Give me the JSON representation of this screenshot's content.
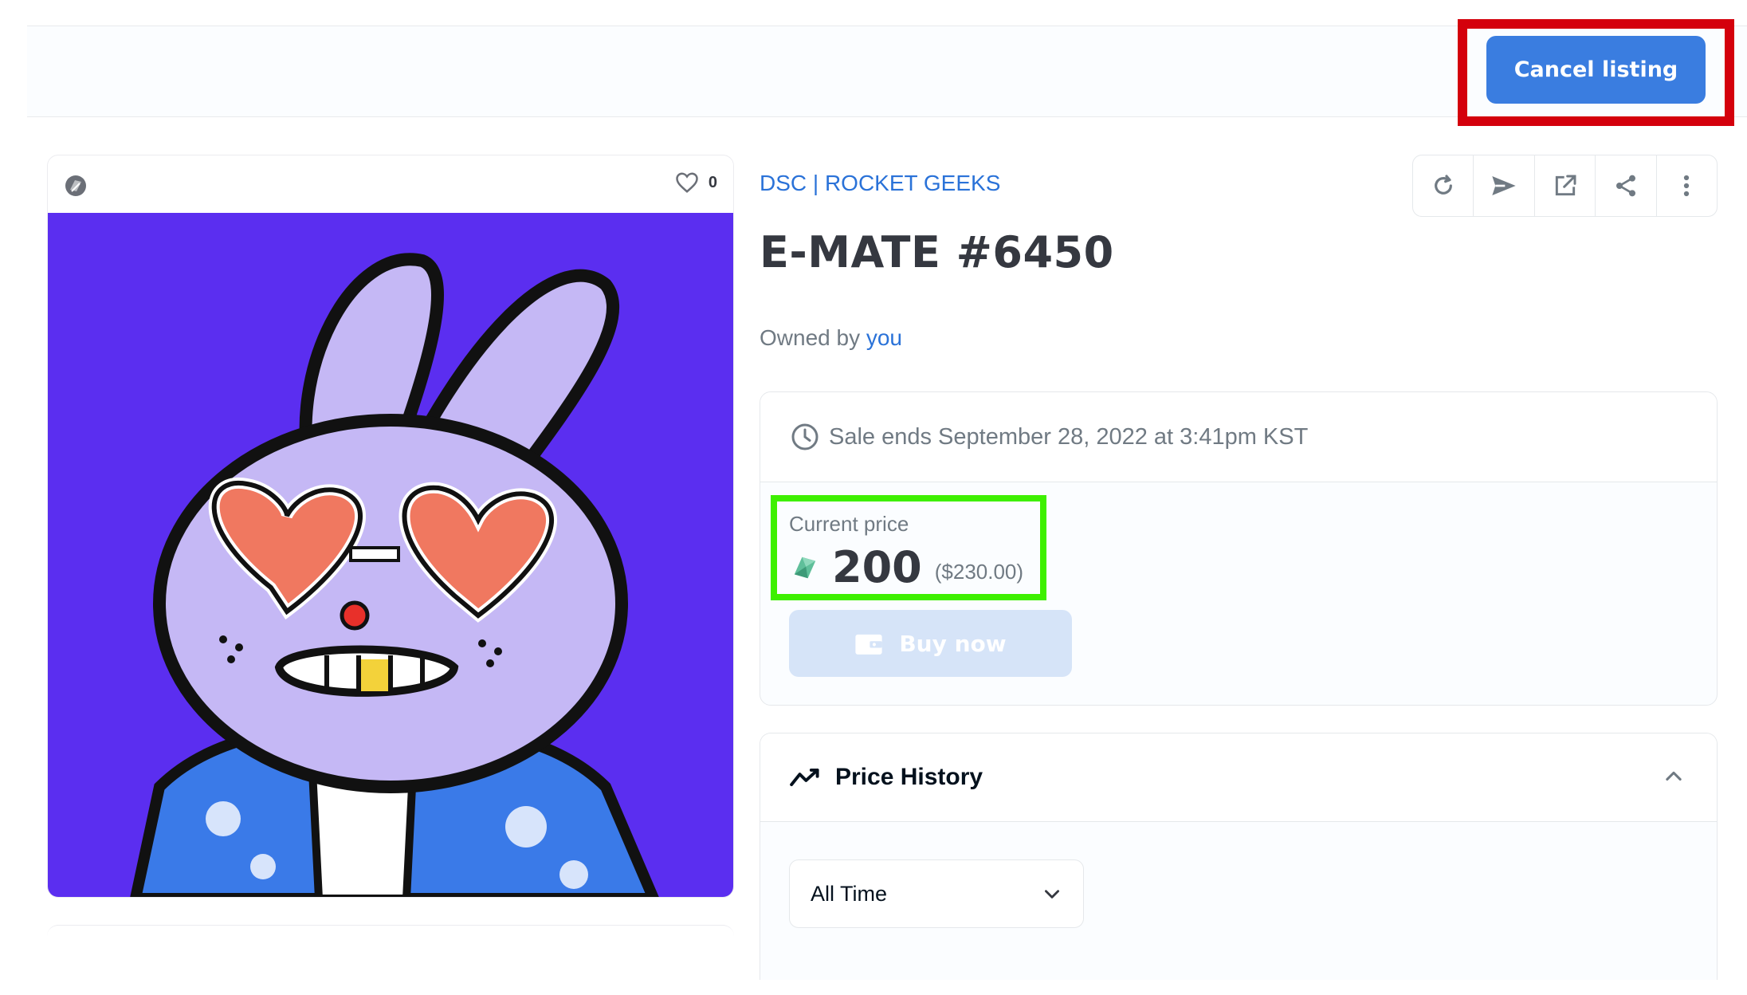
{
  "header": {
    "cancel_label": "Cancel listing"
  },
  "media": {
    "favorite_count": "0",
    "icons": [
      "chain-logo-icon",
      "heart-icon"
    ],
    "art_description_icon": "nft-artwork"
  },
  "item": {
    "collection": "DSC | ROCKET GEEKS",
    "title": "E-MATE #6450",
    "owned_prefix": "Owned by",
    "owner": "you"
  },
  "toolbar": {
    "icons": [
      "refresh-icon",
      "transfer-icon",
      "external-link-icon",
      "share-icon",
      "more-icon"
    ]
  },
  "sale": {
    "ends_text": "Sale ends September 28, 2022 at 3:41pm KST",
    "price_label": "Current price",
    "price_value": "200",
    "price_usd": "($230.00)",
    "buy_label": "Buy now"
  },
  "history": {
    "title": "Price History",
    "range_selected": "All Time"
  },
  "colors": {
    "accent": "#3a7de0",
    "link": "#2a72d8",
    "cancel_highlight": "#d4000c",
    "price_highlight": "#3ef001",
    "art_background": "#5b2ef0"
  }
}
